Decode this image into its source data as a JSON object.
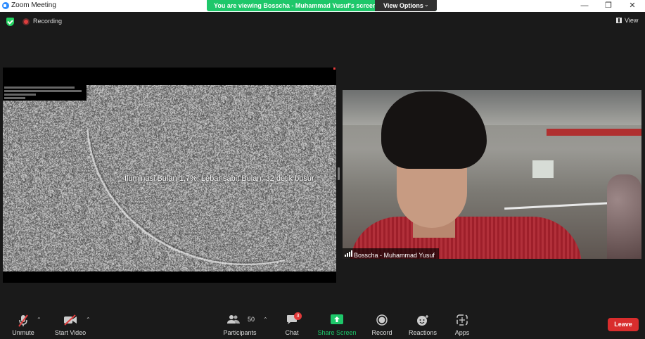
{
  "window": {
    "title": "Zoom Meeting",
    "share_banner": "You are viewing Bosscha - Muhammad Yusuf's screen",
    "view_options": "View Options",
    "minimize": "—",
    "restore": "❐",
    "close": "✕"
  },
  "meeting": {
    "recording_label": "Recording",
    "view_label": "View"
  },
  "shared_screen": {
    "caption": "Iluminasi Bulan 1,7%, Lebar sabit Bulan: 32 detik busur"
  },
  "participant_video": {
    "name": "Bosscha - Muhammad Yusuf"
  },
  "toolbar": {
    "unmute": "Unmute",
    "start_video": "Start Video",
    "participants": "Participants",
    "participants_count": "50",
    "chat": "Chat",
    "chat_badge": "3",
    "share_screen": "Share Screen",
    "record": "Record",
    "reactions": "Reactions",
    "apps": "Apps",
    "leave": "Leave"
  },
  "colors": {
    "share_green": "#1ec76a",
    "leave_red": "#d92d2d",
    "toolbar_bg": "#1a1a1a"
  }
}
